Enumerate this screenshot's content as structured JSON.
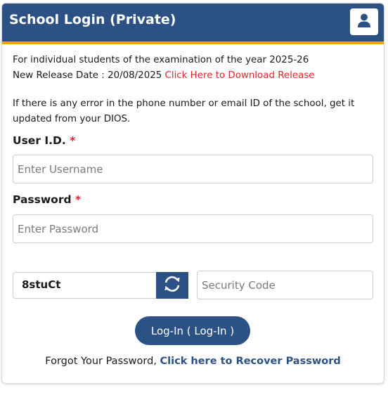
{
  "header": {
    "title": "School Login (Private)",
    "user_icon": "user-icon"
  },
  "info": {
    "line1": "For individual students of the examination of the year 2025-26",
    "release_prefix": "New Release Date : 20/08/2025",
    "release_link": "Click Here to Download Release",
    "error_note": "If there is any error in the phone number or email ID of the school, get it updated from your DIOS."
  },
  "form": {
    "user_id_label": "User I.D.",
    "password_label": "Password",
    "required_mark": "*",
    "username_placeholder": "Enter Username",
    "password_placeholder": "Enter Password",
    "captcha_text": "8stuCt",
    "refresh_icon": "refresh-icon",
    "security_code_placeholder": "Security Code",
    "login_button": "Log-In ( Log-In )"
  },
  "footer": {
    "forgot_prefix": "Forgot Your Password,",
    "recover_link": "Click here to Recover Password"
  },
  "colors": {
    "brand_blue": "#2b5185",
    "accent_orange": "#f0a31a",
    "link_red": "#d9262c"
  }
}
